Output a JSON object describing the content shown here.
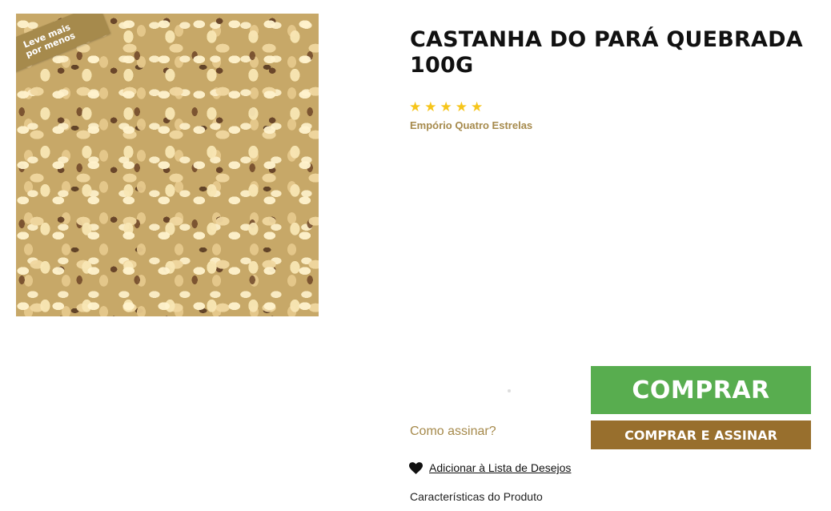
{
  "product": {
    "title": "CASTANHA DO PARÁ QUEBRADA 100G",
    "image_tag": "Leve mais\npor menos",
    "rating": 5,
    "rating_stars": [
      "★",
      "★",
      "★",
      "★",
      "★"
    ],
    "brand": "Empório Quatro Estrelas"
  },
  "actions": {
    "buy_label": "COMPRAR",
    "subscribe_label": "COMPRAR E ASSINAR",
    "how_to_subscribe": "Como assinar?",
    "wishlist_label": "Adicionar à Lista de Desejos",
    "wishlist_icon": "heart-icon",
    "features_label": "Características do Produto"
  },
  "colors": {
    "star": "#f6c51a",
    "brand_gold": "#a68a4c",
    "buy_green": "#58ad4f",
    "subscribe_brown": "#986f2d"
  }
}
